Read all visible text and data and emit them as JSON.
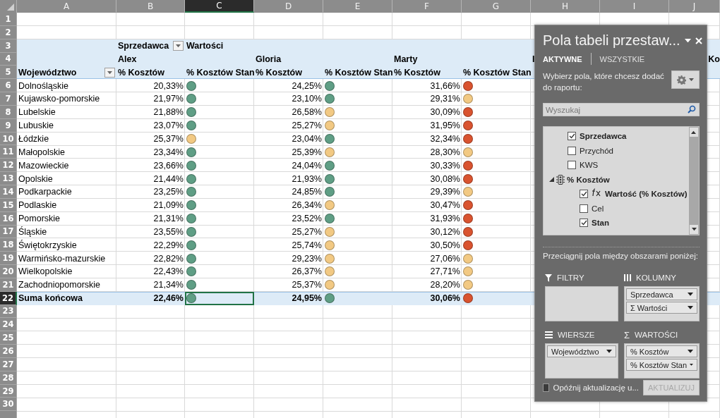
{
  "sheet": {
    "columns": [
      {
        "label": "A",
        "selected": false
      },
      {
        "label": "B",
        "selected": false
      },
      {
        "label": "C",
        "selected": true
      },
      {
        "label": "D",
        "selected": false
      },
      {
        "label": "E",
        "selected": false
      },
      {
        "label": "F",
        "selected": false
      },
      {
        "label": "G",
        "selected": false
      },
      {
        "label": "H",
        "selected": false
      },
      {
        "label": "I",
        "selected": false
      },
      {
        "label": "J",
        "selected": false
      }
    ],
    "rows": [
      {
        "label": "1",
        "selected": false
      },
      {
        "label": "2",
        "selected": false
      },
      {
        "label": "3",
        "selected": false
      },
      {
        "label": "4",
        "selected": false
      },
      {
        "label": "5",
        "selected": false
      },
      {
        "label": "6",
        "selected": false
      },
      {
        "label": "7",
        "selected": false
      },
      {
        "label": "8",
        "selected": false
      },
      {
        "label": "9",
        "selected": false
      },
      {
        "label": "10",
        "selected": false
      },
      {
        "label": "11",
        "selected": false
      },
      {
        "label": "12",
        "selected": false
      },
      {
        "label": "13",
        "selected": false
      },
      {
        "label": "14",
        "selected": false
      },
      {
        "label": "15",
        "selected": false
      },
      {
        "label": "16",
        "selected": false
      },
      {
        "label": "17",
        "selected": false
      },
      {
        "label": "18",
        "selected": false
      },
      {
        "label": "19",
        "selected": false
      },
      {
        "label": "20",
        "selected": false
      },
      {
        "label": "21",
        "selected": false
      },
      {
        "label": "22",
        "selected": true
      },
      {
        "label": "23",
        "selected": false
      },
      {
        "label": "24",
        "selected": false
      },
      {
        "label": "25",
        "selected": false
      },
      {
        "label": "26",
        "selected": false
      },
      {
        "label": "27",
        "selected": false
      },
      {
        "label": "28",
        "selected": false
      },
      {
        "label": "29",
        "selected": false
      },
      {
        "label": "30",
        "selected": false
      }
    ]
  },
  "pivot": {
    "column_field": "Sprzedawca",
    "values_field": "Wartości",
    "row_field": "Województwo",
    "sellers": [
      {
        "name": "Alex",
        "measures": [
          "% Kosztów",
          "% Kosztów Stan"
        ]
      },
      {
        "name": "Gloria",
        "measures": [
          "% Kosztów",
          "% Kosztów Stan"
        ]
      },
      {
        "name": "Marty",
        "measures": [
          "% Kosztów",
          "% Kosztów Stan"
        ]
      },
      {
        "name": "I"
      }
    ],
    "column_j_heading": "Ko",
    "rows": [
      {
        "name": "Dolnośląskie",
        "total": false,
        "cells": [
          {
            "value": "20,33%",
            "color": "#5f9e85",
            "selected": false
          },
          {
            "value": "24,25%",
            "color": "#5f9e85",
            "selected": false
          },
          {
            "value": "31,66%",
            "color": "#d9532f",
            "selected": false
          }
        ]
      },
      {
        "name": "Kujawsko-pomorskie",
        "total": false,
        "cells": [
          {
            "value": "21,97%",
            "color": "#5f9e85",
            "selected": false
          },
          {
            "value": "23,10%",
            "color": "#5f9e85",
            "selected": false
          },
          {
            "value": "29,31%",
            "color": "#f2c983",
            "selected": false
          }
        ]
      },
      {
        "name": "Lubelskie",
        "total": false,
        "cells": [
          {
            "value": "21,88%",
            "color": "#5f9e85",
            "selected": false
          },
          {
            "value": "26,58%",
            "color": "#f2c983",
            "selected": false
          },
          {
            "value": "30,09%",
            "color": "#d9532f",
            "selected": false
          }
        ]
      },
      {
        "name": "Lubuskie",
        "total": false,
        "cells": [
          {
            "value": "23,07%",
            "color": "#5f9e85",
            "selected": false
          },
          {
            "value": "25,27%",
            "color": "#f2c983",
            "selected": false
          },
          {
            "value": "31,95%",
            "color": "#d9532f",
            "selected": false
          }
        ]
      },
      {
        "name": "Łódzkie",
        "total": false,
        "cells": [
          {
            "value": "25,37%",
            "color": "#f2c983",
            "selected": false
          },
          {
            "value": "23,04%",
            "color": "#5f9e85",
            "selected": false
          },
          {
            "value": "32,34%",
            "color": "#d9532f",
            "selected": false
          }
        ]
      },
      {
        "name": "Małopolskie",
        "total": false,
        "cells": [
          {
            "value": "23,34%",
            "color": "#5f9e85",
            "selected": false
          },
          {
            "value": "25,39%",
            "color": "#f2c983",
            "selected": false
          },
          {
            "value": "28,30%",
            "color": "#f2c983",
            "selected": false
          }
        ]
      },
      {
        "name": "Mazowieckie",
        "total": false,
        "cells": [
          {
            "value": "23,66%",
            "color": "#5f9e85",
            "selected": false
          },
          {
            "value": "24,04%",
            "color": "#5f9e85",
            "selected": false
          },
          {
            "value": "30,33%",
            "color": "#d9532f",
            "selected": false
          }
        ]
      },
      {
        "name": "Opolskie",
        "total": false,
        "cells": [
          {
            "value": "21,44%",
            "color": "#5f9e85",
            "selected": false
          },
          {
            "value": "21,93%",
            "color": "#5f9e85",
            "selected": false
          },
          {
            "value": "30,08%",
            "color": "#d9532f",
            "selected": false
          }
        ]
      },
      {
        "name": "Podkarpackie",
        "total": false,
        "cells": [
          {
            "value": "23,25%",
            "color": "#5f9e85",
            "selected": false
          },
          {
            "value": "24,85%",
            "color": "#5f9e85",
            "selected": false
          },
          {
            "value": "29,39%",
            "color": "#f2c983",
            "selected": false
          }
        ]
      },
      {
        "name": "Podlaskie",
        "total": false,
        "cells": [
          {
            "value": "21,09%",
            "color": "#5f9e85",
            "selected": false
          },
          {
            "value": "26,34%",
            "color": "#f2c983",
            "selected": false
          },
          {
            "value": "30,47%",
            "color": "#d9532f",
            "selected": false
          }
        ]
      },
      {
        "name": "Pomorskie",
        "total": false,
        "cells": [
          {
            "value": "21,31%",
            "color": "#5f9e85",
            "selected": false
          },
          {
            "value": "23,52%",
            "color": "#5f9e85",
            "selected": false
          },
          {
            "value": "31,93%",
            "color": "#d9532f",
            "selected": false
          }
        ]
      },
      {
        "name": "Śląskie",
        "total": false,
        "cells": [
          {
            "value": "23,55%",
            "color": "#5f9e85",
            "selected": false
          },
          {
            "value": "25,27%",
            "color": "#f2c983",
            "selected": false
          },
          {
            "value": "30,12%",
            "color": "#d9532f",
            "selected": false
          }
        ]
      },
      {
        "name": "Świętokrzyskie",
        "total": false,
        "cells": [
          {
            "value": "22,29%",
            "color": "#5f9e85",
            "selected": false
          },
          {
            "value": "25,74%",
            "color": "#f2c983",
            "selected": false
          },
          {
            "value": "30,50%",
            "color": "#d9532f",
            "selected": false
          }
        ]
      },
      {
        "name": "Warmińsko-mazurskie",
        "total": false,
        "cells": [
          {
            "value": "22,82%",
            "color": "#5f9e85",
            "selected": false
          },
          {
            "value": "29,23%",
            "color": "#f2c983",
            "selected": false
          },
          {
            "value": "27,06%",
            "color": "#f2c983",
            "selected": false
          }
        ]
      },
      {
        "name": "Wielkopolskie",
        "total": false,
        "cells": [
          {
            "value": "22,43%",
            "color": "#5f9e85",
            "selected": false
          },
          {
            "value": "26,37%",
            "color": "#f2c983",
            "selected": false
          },
          {
            "value": "27,71%",
            "color": "#f2c983",
            "selected": false
          }
        ]
      },
      {
        "name": "Zachodniopomorskie",
        "total": false,
        "cells": [
          {
            "value": "21,34%",
            "color": "#5f9e85",
            "selected": false
          },
          {
            "value": "25,37%",
            "color": "#f2c983",
            "selected": false
          },
          {
            "value": "28,20%",
            "color": "#f2c983",
            "selected": false
          }
        ]
      },
      {
        "name": "Suma końcowa",
        "total": true,
        "cells": [
          {
            "value": "22,46%",
            "color": "#5f9e85",
            "selected": true
          },
          {
            "value": "24,95%",
            "color": "#5f9e85",
            "selected": false
          },
          {
            "value": "30,06%",
            "color": "#d9532f",
            "selected": false
          }
        ]
      }
    ]
  },
  "panel": {
    "title": "Pola tabeli przestaw...",
    "tabs": [
      {
        "label": "AKTYWNE",
        "selected": true
      },
      {
        "label": "WSZYSTKIE",
        "selected": false
      }
    ],
    "instruction": "Wybierz pola, które chcesz dodać do raportu:",
    "search": {
      "placeholder": "Wyszukaj"
    },
    "fields": [
      {
        "kind": "field",
        "label": "Sprzedawca",
        "checked": true
      },
      {
        "kind": "field",
        "label": "Przychód",
        "checked": false
      },
      {
        "kind": "field",
        "label": "KWS",
        "checked": false
      },
      {
        "kind": "kpi",
        "label": "% Kosztów",
        "expanded": true,
        "children": [
          {
            "kind": "formula",
            "label": "Wartość (% Kosztów)",
            "checked": true
          },
          {
            "kind": "field",
            "label": "Cel",
            "checked": false
          },
          {
            "kind": "field",
            "label": "Stan",
            "checked": true
          }
        ]
      }
    ],
    "drag_hint": "Przeciągnij pola między obszarami poniżej:",
    "areas": [
      {
        "kind": "filters",
        "title": "FILTRY"
      },
      {
        "kind": "columns",
        "title": "KOLUMNY",
        "items": [
          "Sprzedawca",
          "Σ  Wartości"
        ]
      },
      {
        "kind": "rows",
        "title": "WIERSZE",
        "items": [
          "Województwo"
        ]
      },
      {
        "kind": "values",
        "symbol": "Σ",
        "title": "WARTOŚCI",
        "items": [
          "% Kosztów",
          "% Kosztów Stan"
        ]
      }
    ],
    "defer": {
      "label": "Opóźnij aktualizację u...",
      "checked": false
    },
    "update_button": {
      "label": "AKTUALIZUJ",
      "disabled": true
    }
  }
}
